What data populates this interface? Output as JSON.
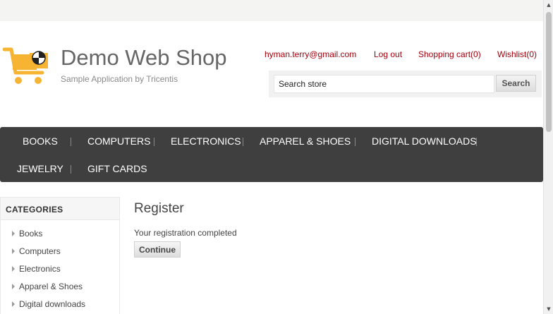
{
  "header": {
    "logo_title": "Demo Web Shop",
    "logo_subtitle": "Sample Application by Tricentis",
    "links": {
      "account": "hyman.terry@gmail.com",
      "logout": "Log out",
      "cart": "Shopping cart(0)",
      "wishlist": "Wishlist(0)"
    },
    "search": {
      "value": "Search store",
      "button_label": "Search"
    }
  },
  "menu": {
    "items": [
      "BOOKS",
      "COMPUTERS",
      "ELECTRONICS",
      "APPAREL & SHOES",
      "DIGITAL DOWNLOADS",
      "JEWELRY",
      "GIFT CARDS"
    ]
  },
  "sidebar": {
    "title": "CATEGORIES",
    "items": [
      "Books",
      "Computers",
      "Electronics",
      "Apparel & Shoes",
      "Digital downloads"
    ]
  },
  "main": {
    "title": "Register",
    "result": "Your registration completed",
    "continue_label": "Continue"
  },
  "colors": {
    "link": "#a3000b",
    "menu_bg": "#3f3f3f",
    "logo_orange": "#f7b433"
  },
  "icons": {
    "logo": "shopping-cart-icon"
  }
}
